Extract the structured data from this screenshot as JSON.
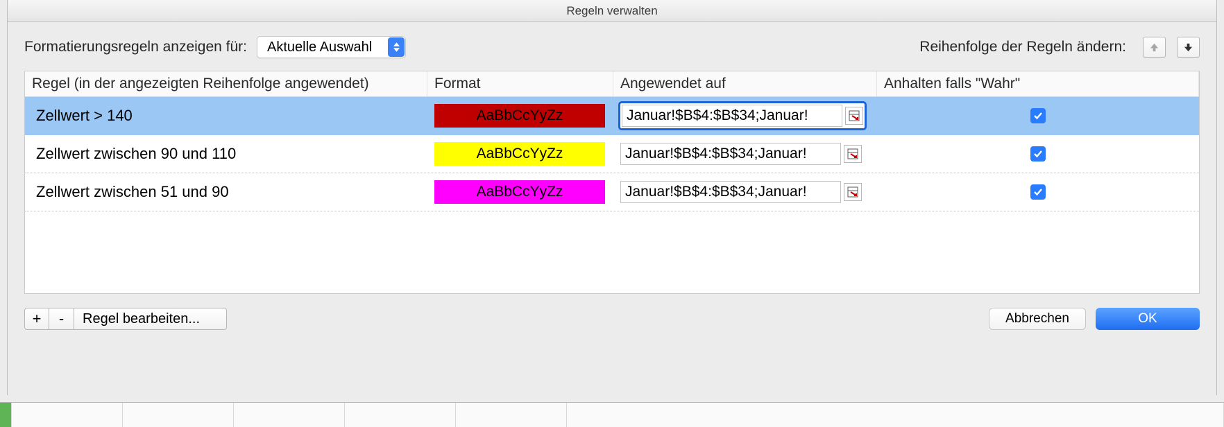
{
  "window": {
    "title": "Regeln verwalten"
  },
  "top": {
    "show_rules_label": "Formatierungsregeln anzeigen für:",
    "scope_options": [
      "Aktuelle Auswahl"
    ],
    "scope_selected": "Aktuelle Auswahl",
    "reorder_label": "Reihenfolge der Regeln ändern:"
  },
  "table": {
    "headers": {
      "rule": "Regel (in der angezeigten Reihenfolge angewendet)",
      "format": "Format",
      "applied_to": "Angewendet auf",
      "stop_if_true": "Anhalten falls \"Wahr\""
    },
    "format_sample": "AaBbCcYyZz",
    "rows": [
      {
        "rule": "Zellwert > 140",
        "bg": "#c00000",
        "fg": "#000000",
        "range": "Januar!$B$4:$B$34;Januar!",
        "stop": true,
        "selected": true
      },
      {
        "rule": "Zellwert zwischen 90 und 110",
        "bg": "#ffff00",
        "fg": "#000000",
        "range": "Januar!$B$4:$B$34;Januar!",
        "stop": true,
        "selected": false
      },
      {
        "rule": "Zellwert zwischen 51 und 90",
        "bg": "#ff00ff",
        "fg": "#000000",
        "range": "Januar!$B$4:$B$34;Januar!",
        "stop": true,
        "selected": false
      }
    ]
  },
  "footer": {
    "add": "+",
    "remove": "-",
    "edit_rule": "Regel bearbeiten...",
    "cancel": "Abbrechen",
    "ok": "OK"
  }
}
